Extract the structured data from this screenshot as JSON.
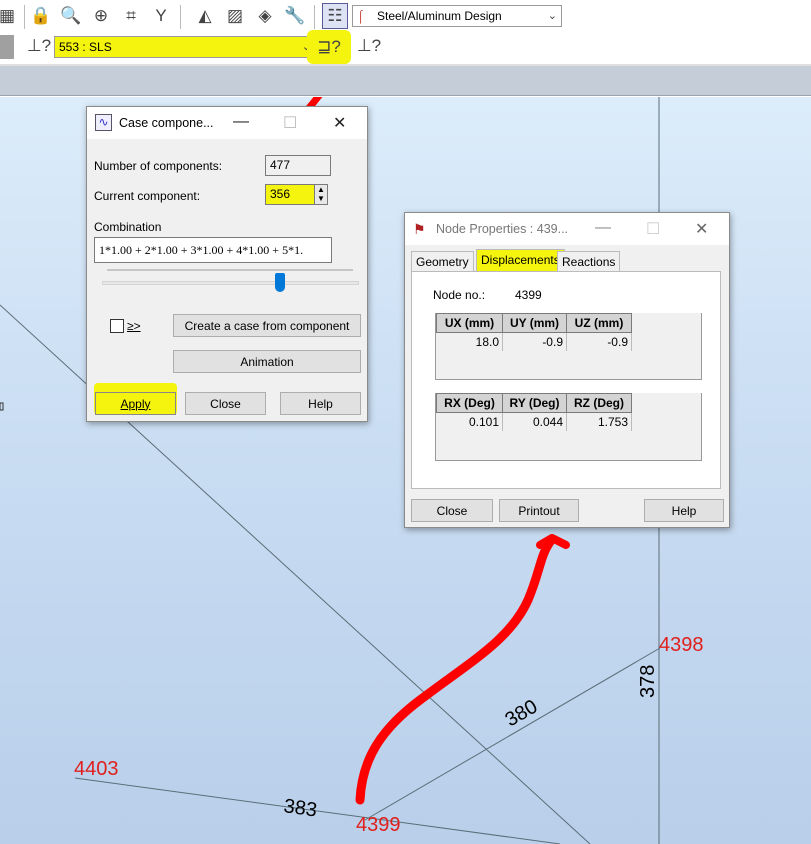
{
  "toolbar": {
    "design_combo": "Steel/Aluminum Design",
    "load_case_combo": "553 : SLS"
  },
  "case_components": {
    "title": "Case compone...",
    "num_components_label": "Number of components:",
    "num_components_value": "477",
    "current_component_label": "Current component:",
    "current_component_value": "356",
    "combination_label": "Combination",
    "combination_value": "1*1.00 + 2*1.00 + 3*1.00 + 4*1.00 + 5*1.",
    "checkbox_label": "≥>",
    "create_case_label": "Create a case from component",
    "animation_label": "Animation",
    "apply_label": "Apply",
    "close_label": "Close",
    "help_label": "Help",
    "slider_position": 0.7
  },
  "node_properties": {
    "title": "Node Properties : 439...",
    "tabs": [
      "Geometry",
      "Displacements",
      "Reactions"
    ],
    "active_tab": "Displacements",
    "node_no_label": "Node no.:",
    "node_no_value": "4399",
    "translations": {
      "headers": [
        "UX (mm)",
        "UY (mm)",
        "UZ (mm)"
      ],
      "values": [
        "18.0",
        "-0.9",
        "-0.9"
      ]
    },
    "rotations": {
      "headers": [
        "RX (Deg)",
        "RY (Deg)",
        "RZ (Deg)"
      ],
      "values": [
        "0.101",
        "0.044",
        "1.753"
      ]
    },
    "close_label": "Close",
    "printout_label": "Printout",
    "help_label": "Help"
  },
  "model": {
    "node_labels": [
      "4398",
      "4399",
      "4403"
    ],
    "bar_labels": [
      "378",
      "380",
      "383"
    ]
  },
  "colors": {
    "highlight": "#f4f40e",
    "annotation": "#ff0000",
    "node_label": "#e0201c",
    "bar_line": "#5a6e78"
  }
}
